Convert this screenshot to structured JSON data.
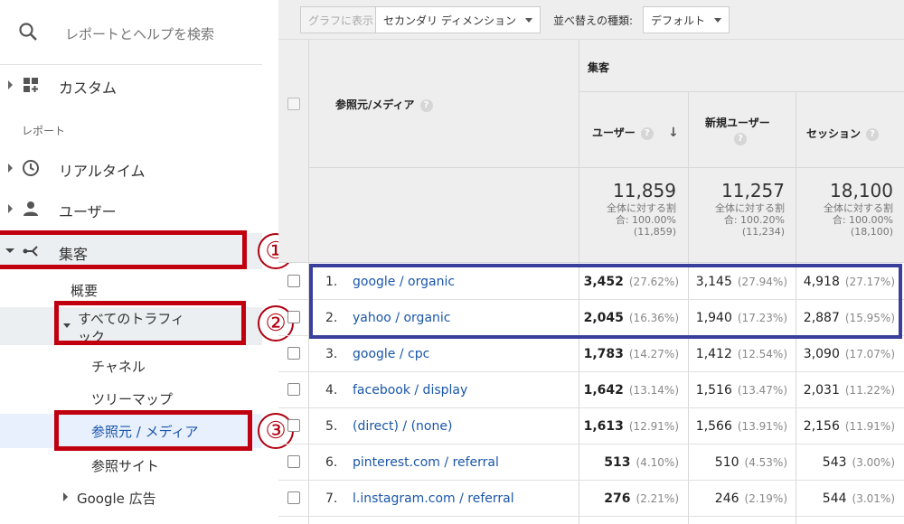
{
  "sidebar": {
    "search_placeholder": "レポートとヘルプを検索",
    "custom_label": "カスタム",
    "reports_section": "レポート",
    "realtime_label": "リアルタイム",
    "users_label": "ユーザー",
    "acquisition_label": "集客",
    "overview_label": "概要",
    "all_traffic_line1": "すべてのトラフィ",
    "all_traffic_line2": "ック",
    "channels_label": "チャネル",
    "treemap_label": "ツリーマップ",
    "source_medium_label": "参照元 / メディア",
    "referrals_label": "参照サイト",
    "google_ads_label": "Google 広告",
    "annotations": [
      "①",
      "②",
      "③"
    ]
  },
  "toolbar": {
    "chart_button": "グラフに表示",
    "secondary_dimension": "セカンダリ ディメンション",
    "sort_label": "並べ替えの種類:",
    "sort_value": "デフォルト"
  },
  "table": {
    "dimension_header": "参照元/メディア",
    "group_header": "集客",
    "col_users": "ユーザー",
    "col_new_users": "新規ユーザー",
    "col_sessions": "セッション",
    "totals": [
      {
        "value": "11,859",
        "note1": "全体に対する割",
        "note2": "合: 100.00%",
        "note3": "(11,859)"
      },
      {
        "value": "11,257",
        "note1": "全体に対する割",
        "note2": "合: 100.20%",
        "note3": "(11,234)"
      },
      {
        "value": "18,100",
        "note1": "全体に対する割",
        "note2": "合: 100.00%",
        "note3": "(18,100)"
      }
    ],
    "rows": [
      {
        "idx": "1.",
        "source": "google / organic",
        "users": "3,452",
        "users_pct": "(27.62%)",
        "new_users": "3,145",
        "new_users_pct": "(27.94%)",
        "sessions": "4,918",
        "sessions_pct": "(27.17%)"
      },
      {
        "idx": "2.",
        "source": "yahoo / organic",
        "users": "2,045",
        "users_pct": "(16.36%)",
        "new_users": "1,940",
        "new_users_pct": "(17.23%)",
        "sessions": "2,887",
        "sessions_pct": "(15.95%)"
      },
      {
        "idx": "3.",
        "source": "google / cpc",
        "users": "1,783",
        "users_pct": "(14.27%)",
        "new_users": "1,412",
        "new_users_pct": "(12.54%)",
        "sessions": "3,090",
        "sessions_pct": "(17.07%)"
      },
      {
        "idx": "4.",
        "source": "facebook / display",
        "users": "1,642",
        "users_pct": "(13.14%)",
        "new_users": "1,516",
        "new_users_pct": "(13.47%)",
        "sessions": "2,031",
        "sessions_pct": "(11.22%)"
      },
      {
        "idx": "5.",
        "source": "(direct) / (none)",
        "users": "1,613",
        "users_pct": "(12.91%)",
        "new_users": "1,566",
        "new_users_pct": "(13.91%)",
        "sessions": "2,156",
        "sessions_pct": "(11.91%)"
      },
      {
        "idx": "6.",
        "source": "pinterest.com / referral",
        "users": "513",
        "users_pct": "(4.10%)",
        "new_users": "510",
        "new_users_pct": "(4.53%)",
        "sessions": "543",
        "sessions_pct": "(3.00%)"
      },
      {
        "idx": "7.",
        "source": "l.instagram.com / referral",
        "users": "276",
        "users_pct": "(2.21%)",
        "new_users": "246",
        "new_users_pct": "(2.19%)",
        "sessions": "544",
        "sessions_pct": "(3.01%)"
      }
    ]
  },
  "colors": {
    "annotation_red": "#c0000f",
    "highlight_blue": "#3a3f9c",
    "link_blue": "#1a56a8"
  }
}
